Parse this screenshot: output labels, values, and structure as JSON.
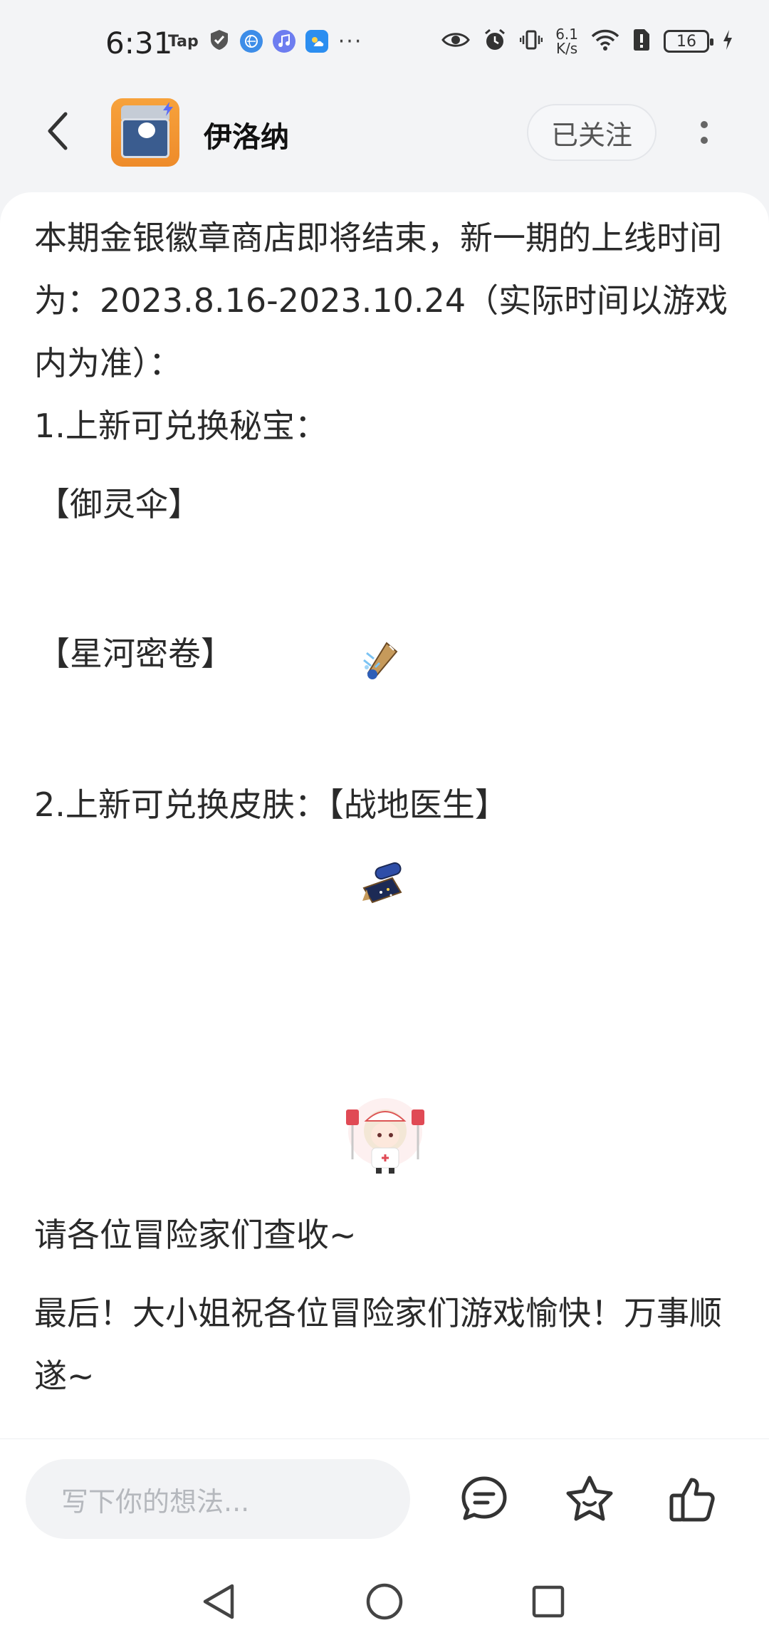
{
  "status_bar": {
    "time": "6:31",
    "tap_label": "Tap",
    "more": "···",
    "speed_value": "6.1",
    "speed_unit": "K/s",
    "battery": "16"
  },
  "header": {
    "author_name": "伊洛纳",
    "follow_label": "已关注"
  },
  "post": {
    "paragraphs": [
      "本期金银徽章商店即将结束，新一期的上线时间为：2023.8.16-2023.10.24（实际时间以游戏内为准）：",
      "1.上新可兑换秘宝：",
      "【御灵伞】",
      "【星河密卷】",
      "2.上新可兑换皮肤：【战地医生】",
      "请各位冒险家们查收~",
      "最后！大小姐祝各位冒险家们游戏愉快！万事顺遂~"
    ],
    "images": [
      {
        "name": "umbrella-item",
        "icon": "umbrella"
      },
      {
        "name": "scroll-item",
        "icon": "scroll"
      },
      {
        "name": "nurse-skin",
        "icon": "chibi-nurse"
      }
    ]
  },
  "bottom_bar": {
    "comment_placeholder": "写下你的想法...",
    "icons": [
      "comment-icon",
      "favorite-star-icon",
      "like-thumb-icon"
    ]
  },
  "nav": {
    "icons": [
      "nav-back-icon",
      "nav-home-icon",
      "nav-recents-icon"
    ]
  },
  "colors": {
    "accent_blue": "#2f7be8",
    "text": "#2a2a2a",
    "placeholder": "#b5b8bd",
    "avatar_orange": "#f29a33"
  }
}
